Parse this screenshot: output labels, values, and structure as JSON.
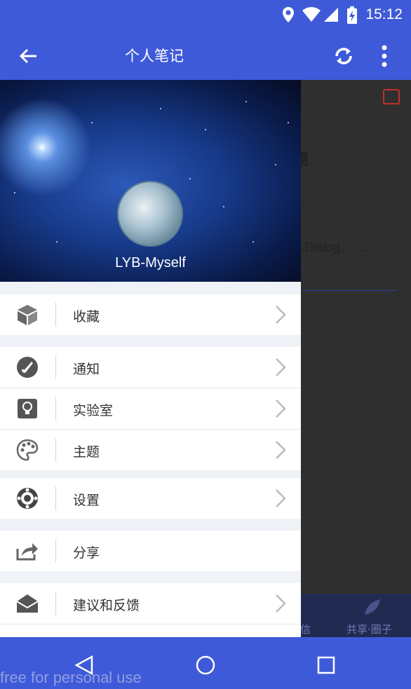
{
  "status_bar": {
    "time": "15:12"
  },
  "app_bar": {
    "title": "个人笔记"
  },
  "background": {
    "text1": "题",
    "text2": "-Dialog。 ...",
    "tab1_label": "信",
    "tab2_label": "共享·圈子"
  },
  "drawer": {
    "username": "LYB-Myself",
    "items": [
      {
        "label": "收藏",
        "icon": "cube-icon"
      },
      {
        "label": "通知",
        "icon": "rocket-icon"
      },
      {
        "label": "实验室",
        "icon": "bulb-icon"
      },
      {
        "label": "主题",
        "icon": "palette-icon"
      },
      {
        "label": "设置",
        "icon": "gear-icon"
      },
      {
        "label": "分享",
        "icon": "share-icon"
      },
      {
        "label": "建议和反馈",
        "icon": "mail-icon"
      }
    ]
  },
  "watermark": "free for personal use"
}
